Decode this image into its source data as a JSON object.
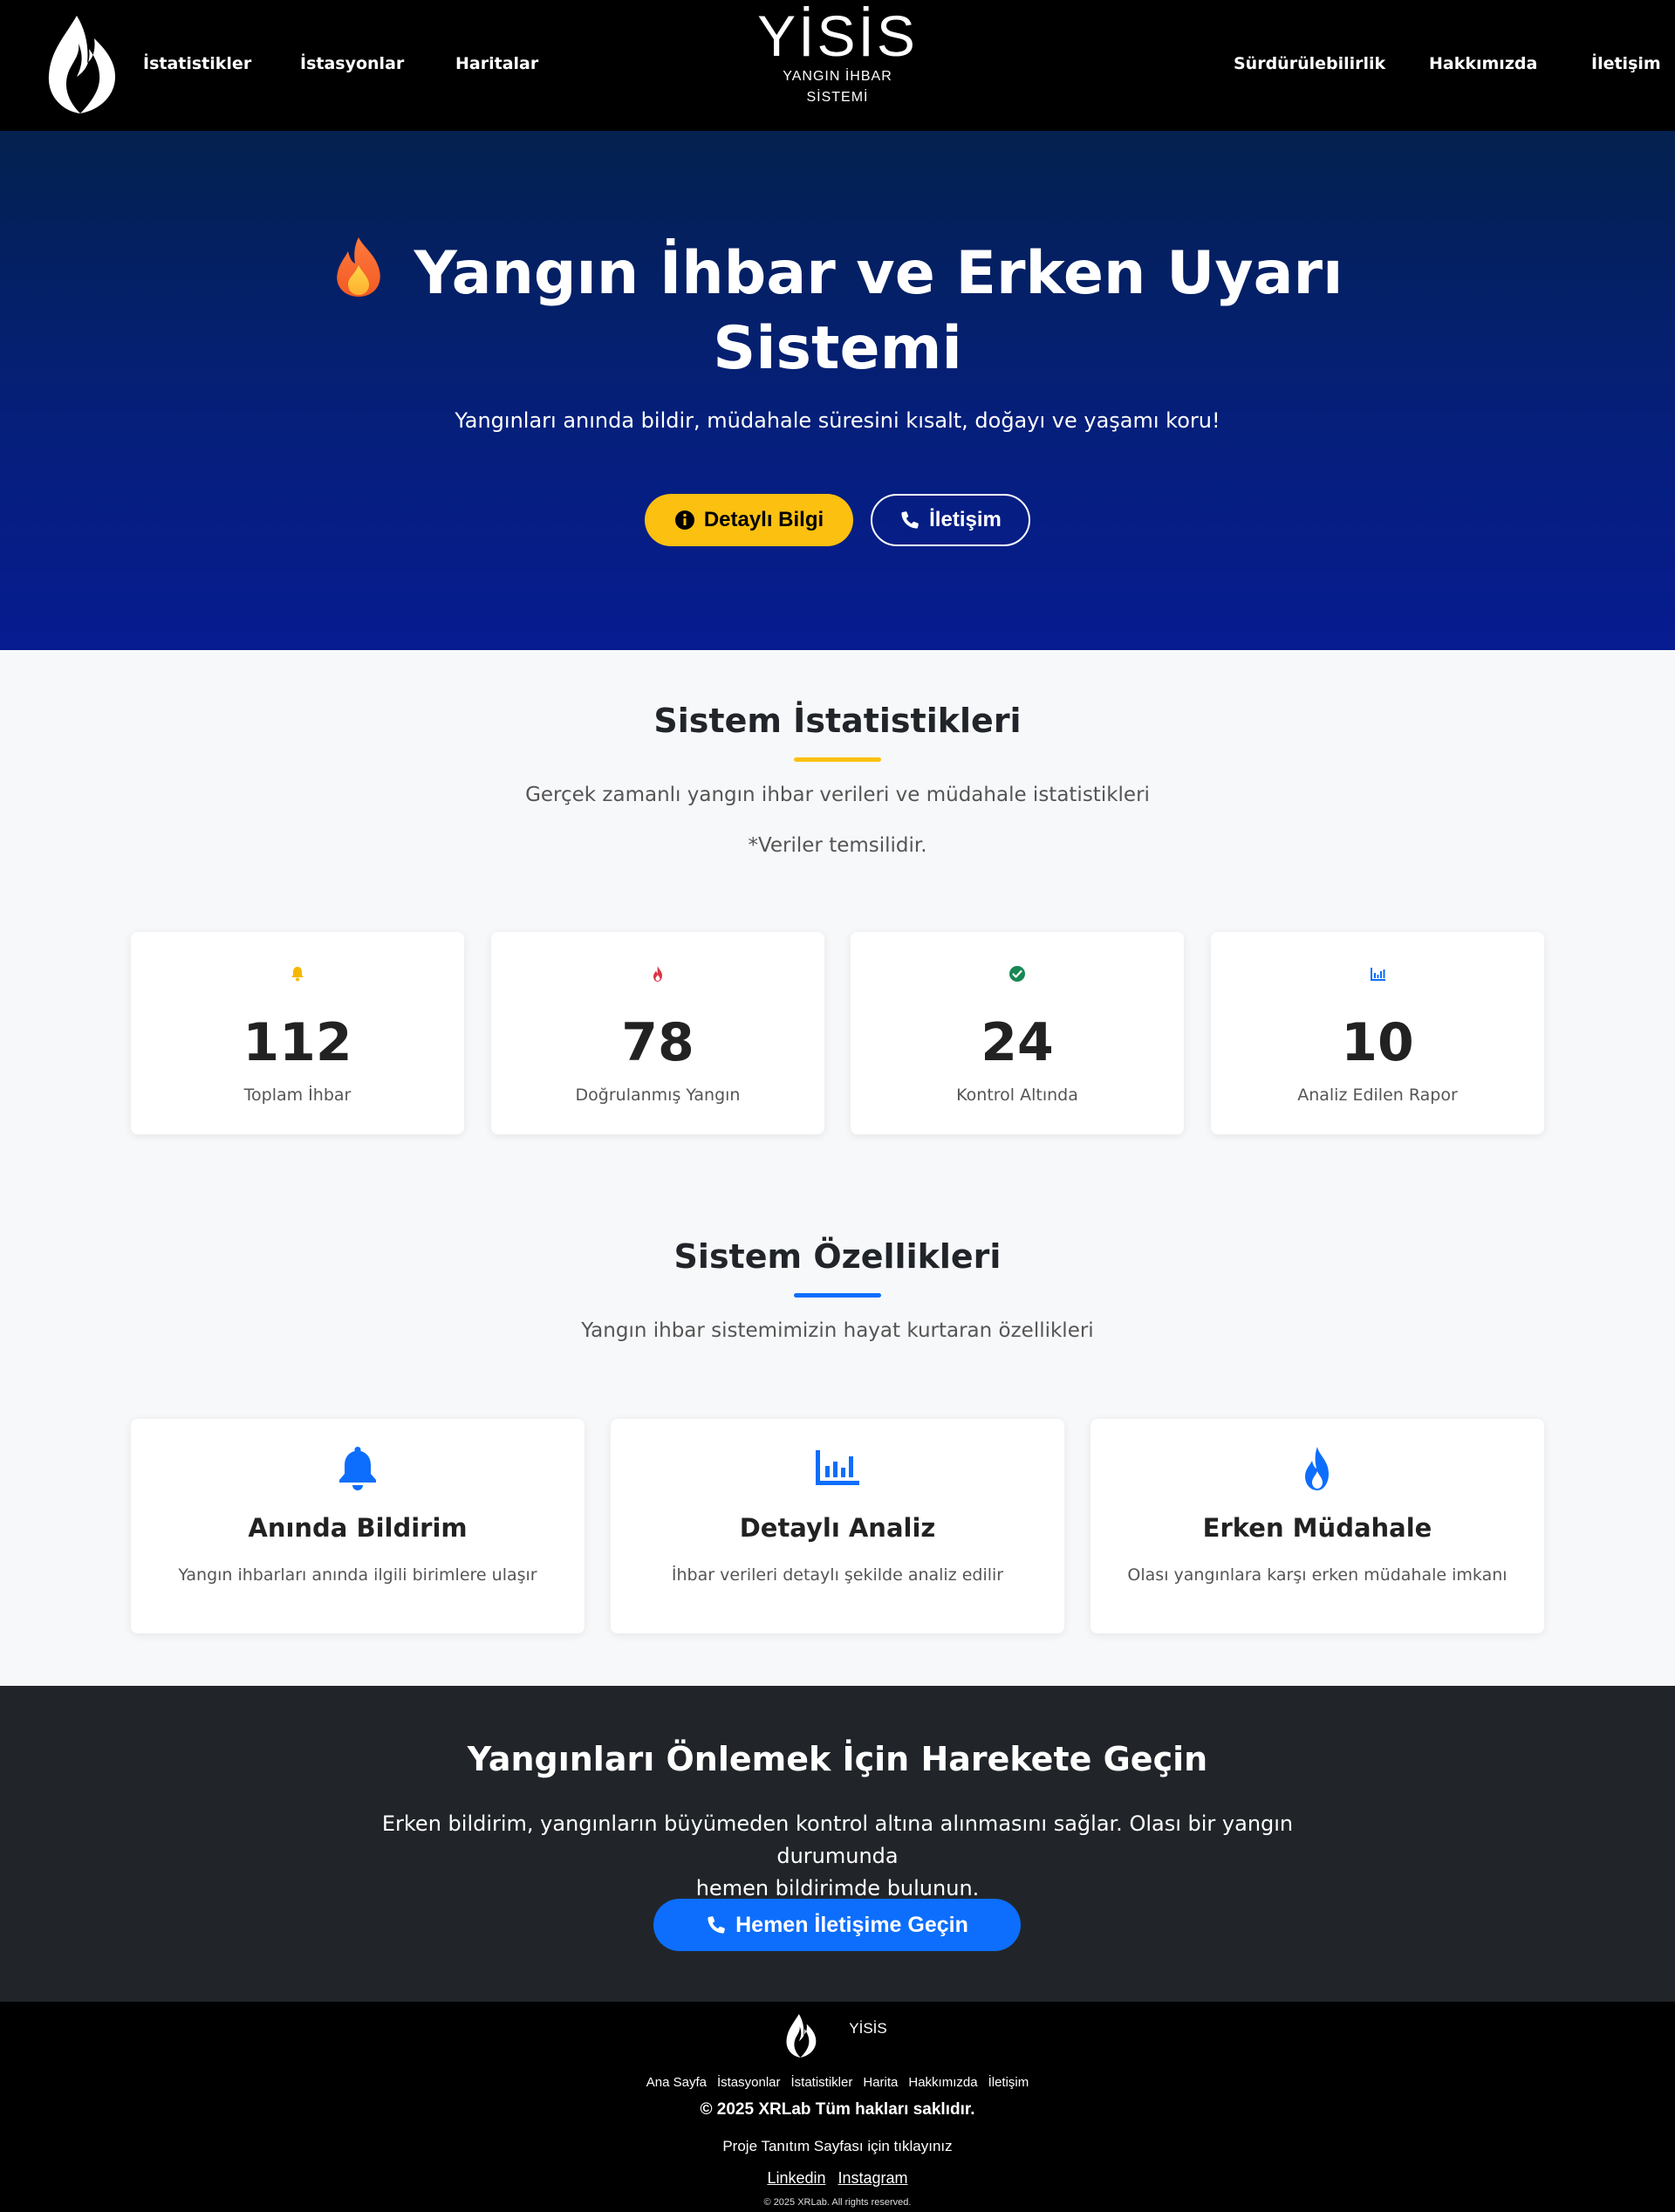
{
  "nav": {
    "brand_name": "YİSİS",
    "brand_sub_line1": "YANGIN İHBAR",
    "brand_sub_line2": "SİSTEMİ",
    "links_left": [
      "İstatistikler",
      "İstasyonlar",
      "Haritalar"
    ],
    "links_right": [
      "Sürdürülebilirlik",
      "Hakkımızda",
      "İletişim"
    ],
    "logo_icon": "flame-logo-icon"
  },
  "hero": {
    "title_line1": "Yangın İhbar ve Erken Uyarı",
    "title_line2": "Sistemi",
    "title_icon": "fire-emoji-icon",
    "subtitle": "Yangınları anında bildir, müdahale süresini kısalt, doğayı ve yaşamı koru!",
    "btn_info_label": "Detaylı Bilgi",
    "btn_info_icon": "info-circle-icon",
    "btn_contact_label": "İletişim",
    "btn_contact_icon": "phone-icon"
  },
  "stats": {
    "title": "Sistem İstatistikleri",
    "description": "Gerçek zamanlı yangın ihbar verileri ve müdahale istatistikleri",
    "note": "*Veriler temsilidir.",
    "items": [
      {
        "value": "112",
        "label": "Toplam İhbar",
        "icon": "bell-icon",
        "color": "#f5b800"
      },
      {
        "value": "78",
        "label": "Doğrulanmış Yangın",
        "icon": "fire-icon",
        "color": "#dc3545"
      },
      {
        "value": "24",
        "label": "Kontrol Altında",
        "icon": "check-circle-icon",
        "color": "#198754"
      },
      {
        "value": "10",
        "label": "Analiz Edilen Rapor",
        "icon": "chart-bar-icon",
        "color": "#0d6efd"
      }
    ]
  },
  "features": {
    "title": "Sistem Özellikleri",
    "description": "Yangın ihbar sistemimizin hayat kurtaran özellikleri",
    "items": [
      {
        "title": "Anında Bildirim",
        "desc": "Yangın ihbarları anında ilgili birimlere ulaşır",
        "icon": "bell-icon"
      },
      {
        "title": "Detaylı Analiz",
        "desc": "İhbar verileri detaylı şekilde analiz edilir",
        "icon": "chart-bar-icon"
      },
      {
        "title": "Erken Müdahale",
        "desc": "Olası yangınlara karşı erken müdahale imkanı",
        "icon": "fire-icon"
      }
    ]
  },
  "cta": {
    "title": "Yangınları Önlemek İçin Harekete Geçin",
    "desc_line1": "Erken bildirim, yangınların büyümeden kontrol altına alınmasını sağlar. Olası bir yangın durumunda",
    "desc_line2": "hemen bildirimde bulunun.",
    "btn_label": "Hemen İletişime Geçin",
    "btn_icon": "phone-icon"
  },
  "footer": {
    "brand_name": "YİSİS",
    "links": [
      "Ana Sayfa",
      "İstasyonlar",
      "İstatistikler",
      "Harita",
      "Hakkımızda",
      "İletişim"
    ],
    "copyright": "© 2025 XRLab Tüm hakları saklıdır.",
    "project_link": "Proje Tanıtım Sayfası için tıklayınız",
    "social": [
      "Linkedin",
      "Instagram"
    ],
    "small_copy": "© 2025 XRLab. All rights reserved."
  },
  "colors": {
    "accent_yellow": "#fcc010",
    "accent_blue": "#0d6efd",
    "hero_top": "#04214f",
    "hero_bottom": "#061c91",
    "dark": "#212529"
  }
}
